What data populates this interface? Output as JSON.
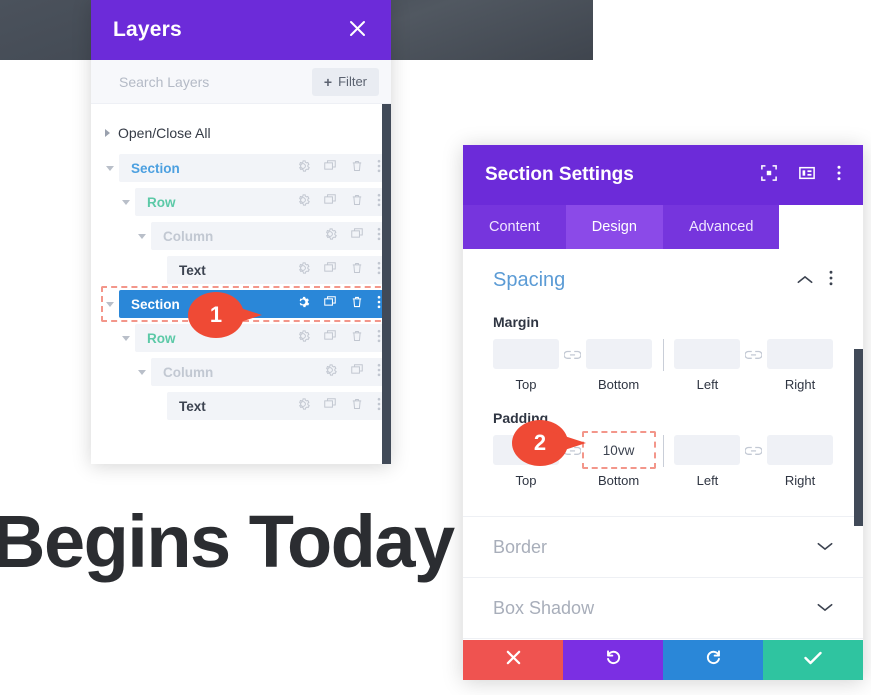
{
  "background": {
    "headline": "Begins Today"
  },
  "layers_panel": {
    "title": "Layers",
    "close_icon": "close-icon",
    "search": {
      "value": "",
      "placeholder": "Search Layers"
    },
    "filter_button": {
      "label": "Filter",
      "plus": "+"
    },
    "open_close_all": "Open/Close All",
    "rows": [
      {
        "label": "Section",
        "type": "section",
        "depth": 0,
        "caret": "open",
        "selected": false,
        "icons": [
          "gear-icon",
          "duplicate-icon",
          "trash-icon",
          "more-vertical-icon"
        ]
      },
      {
        "label": "Row",
        "type": "row",
        "depth": 1,
        "caret": "open",
        "selected": false,
        "icons": [
          "gear-icon",
          "duplicate-icon",
          "trash-icon",
          "more-vertical-icon"
        ]
      },
      {
        "label": "Column",
        "type": "column",
        "depth": 2,
        "caret": "open",
        "selected": false,
        "icons": [
          "gear-icon",
          "duplicate-icon",
          "more-vertical-icon"
        ]
      },
      {
        "label": "Text",
        "type": "text",
        "depth": 3,
        "caret": "none",
        "selected": false,
        "icons": [
          "gear-icon",
          "duplicate-icon",
          "trash-icon",
          "more-vertical-icon"
        ]
      },
      {
        "label": "Section",
        "type": "section",
        "depth": 0,
        "caret": "open",
        "selected": true,
        "icons": [
          "gear-icon",
          "duplicate-icon",
          "trash-icon",
          "more-vertical-icon"
        ]
      },
      {
        "label": "Row",
        "type": "row",
        "depth": 1,
        "caret": "open",
        "selected": false,
        "icons": [
          "gear-icon",
          "duplicate-icon",
          "trash-icon",
          "more-vertical-icon"
        ]
      },
      {
        "label": "Column",
        "type": "column",
        "depth": 2,
        "caret": "open",
        "selected": false,
        "icons": [
          "gear-icon",
          "duplicate-icon",
          "more-vertical-icon"
        ]
      },
      {
        "label": "Text",
        "type": "text",
        "depth": 3,
        "caret": "none",
        "selected": false,
        "icons": [
          "gear-icon",
          "duplicate-icon",
          "trash-icon",
          "more-vertical-icon"
        ]
      }
    ]
  },
  "settings_panel": {
    "title": "Section Settings",
    "header_icons": [
      "expand-icon",
      "layout-panel-icon",
      "more-vertical-icon"
    ],
    "tabs": [
      {
        "label": "Content",
        "active": false
      },
      {
        "label": "Design",
        "active": true
      },
      {
        "label": "Advanced",
        "active": false
      }
    ],
    "spacing": {
      "title": "Spacing",
      "collapse_icon": "chevron-up-icon",
      "more_icon": "more-vertical-icon",
      "margin": {
        "label": "Margin",
        "fields": [
          {
            "caption": "Top",
            "value": "",
            "highlight": false
          },
          {
            "caption": "Bottom",
            "value": "",
            "highlight": false
          },
          {
            "caption": "Left",
            "value": "",
            "highlight": false
          },
          {
            "caption": "Right",
            "value": "",
            "highlight": false
          }
        ]
      },
      "padding": {
        "label": "Padding",
        "fields": [
          {
            "caption": "Top",
            "value": "",
            "highlight": false
          },
          {
            "caption": "Bottom",
            "value": "10vw",
            "highlight": true
          },
          {
            "caption": "Left",
            "value": "",
            "highlight": false
          },
          {
            "caption": "Right",
            "value": "",
            "highlight": false
          }
        ]
      }
    },
    "accordions": [
      {
        "label": "Border",
        "icon": "chevron-down-icon"
      },
      {
        "label": "Box Shadow",
        "icon": "chevron-down-icon"
      }
    ],
    "footer_buttons": [
      {
        "name": "cancel-button",
        "icon": "close-icon",
        "color": "#ef5350"
      },
      {
        "name": "undo-button",
        "icon": "undo-icon",
        "color": "#7b2fe3"
      },
      {
        "name": "redo-button",
        "icon": "redo-icon",
        "color": "#2a87d8"
      },
      {
        "name": "save-button",
        "icon": "check-icon",
        "color": "#2fc4a0"
      }
    ]
  },
  "callouts": [
    {
      "number": "1",
      "target": "layer-row-section-selected"
    },
    {
      "number": "2",
      "target": "padding-bottom-field"
    }
  ]
}
